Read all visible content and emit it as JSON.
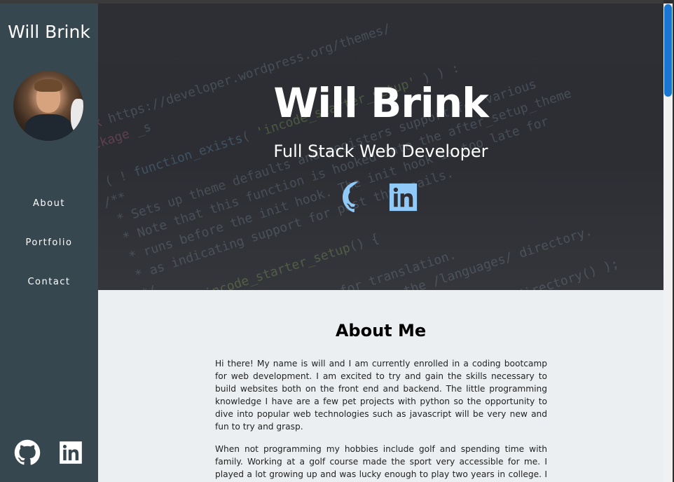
{
  "sidebar": {
    "brand": "Will Brink",
    "nav": [
      "About",
      "Portfolio",
      "Contact"
    ],
    "social": [
      "github-icon",
      "linkedin-icon"
    ]
  },
  "hero": {
    "title": "Will Brink",
    "subtitle": "Full Stack Web Developer",
    "social": [
      "github-icon",
      "linkedin-icon"
    ]
  },
  "about": {
    "heading": "About Me",
    "paragraphs": [
      "Hi there! My name is will and I am currently enrolled in a coding bootcamp for web development. I am excited to try and gain the skills necessary to build websites both on the front end and backend. The little programming knowledge I have are a few pet projects with python so the opportunity to dive into popular web technologies such as javascript will be very new and fun to try and grasp.",
      "When not programming my hobbies include golf and spending time with family. Working at a golf course made the sport very accessible for me. I played a lot growing up and was lucky enough to play two years in college. I enjoy"
    ]
  },
  "colors": {
    "sidebar": "#37474f",
    "accent": "#90caf9",
    "about_bg": "#eceff1",
    "scroll_thumb": "#1976d2"
  }
}
